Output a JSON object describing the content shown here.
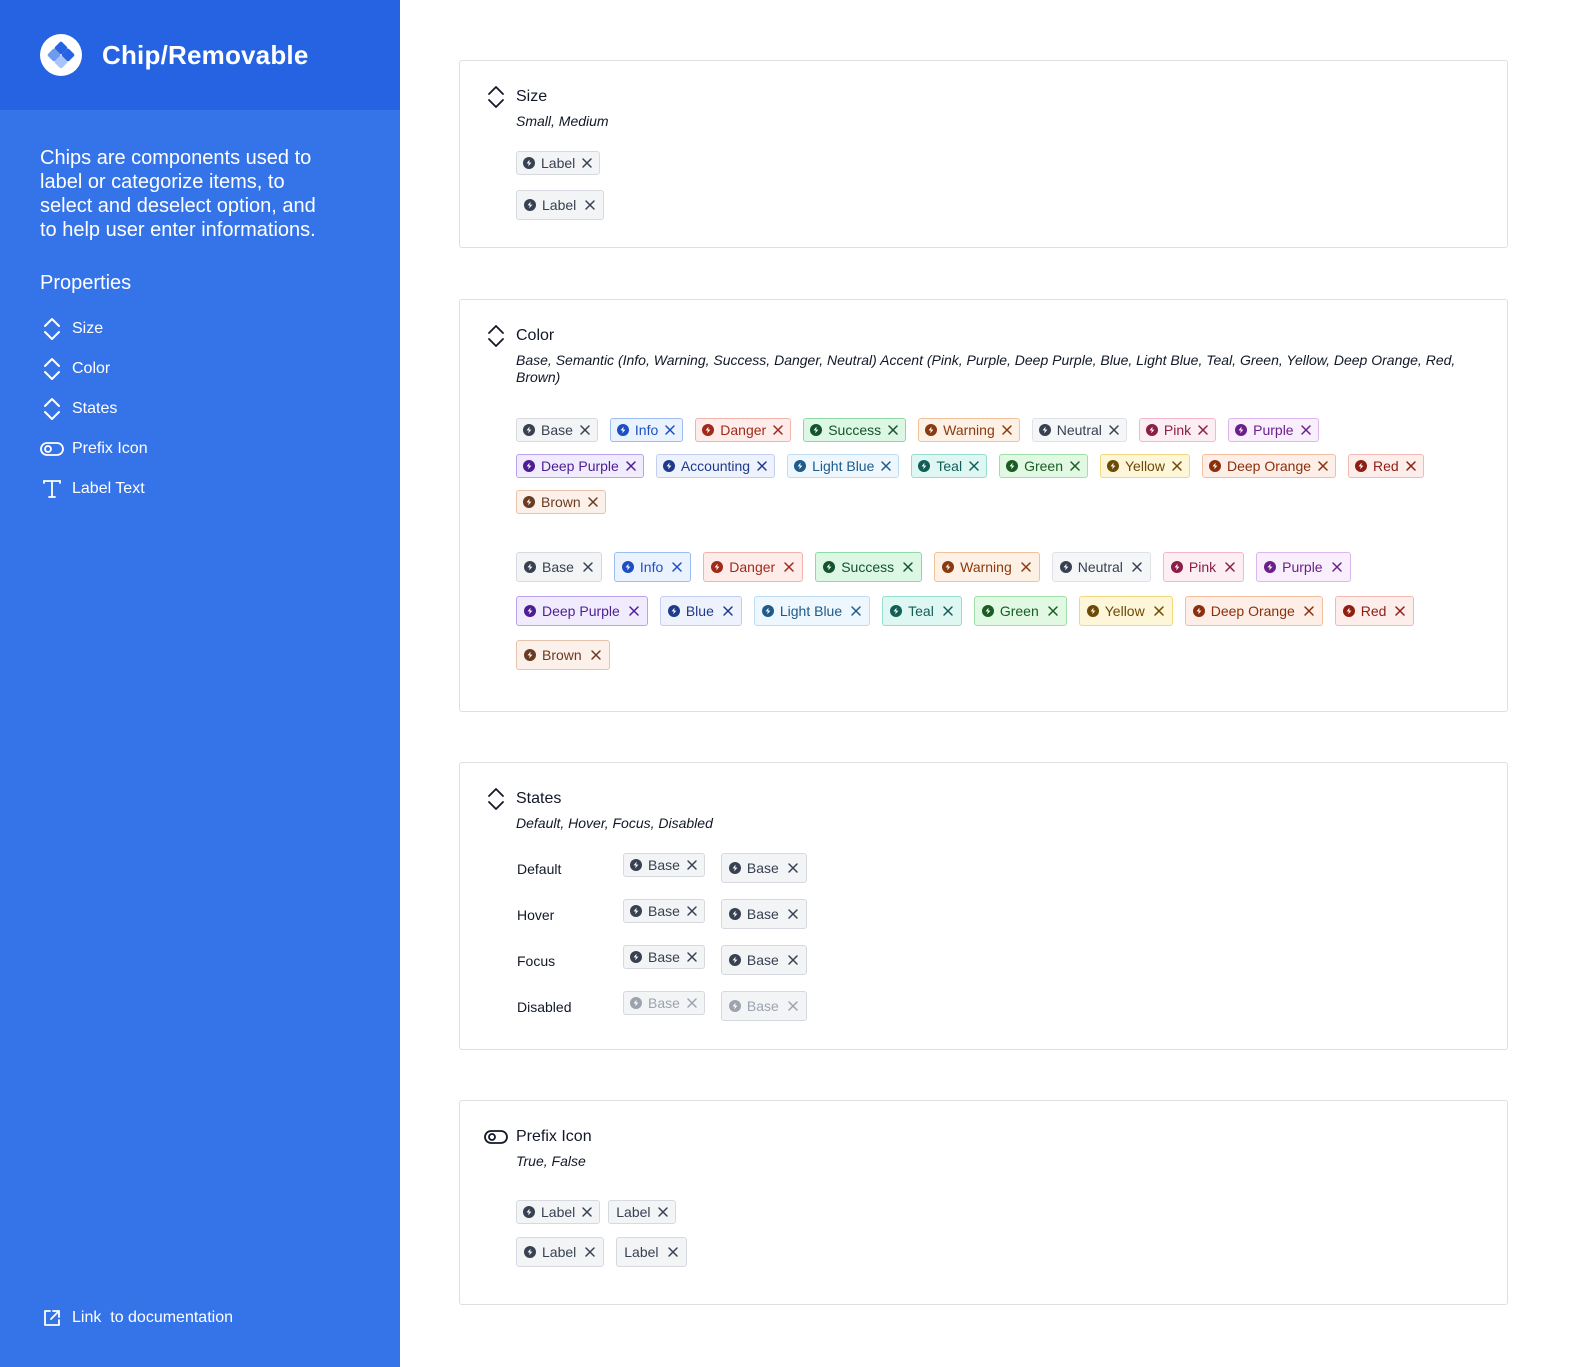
{
  "sidebar": {
    "title": "Chip/Removable",
    "description": "Chips are components used to label or categorize items, to select and deselect option, and to help user enter informations.",
    "properties_title": "Properties",
    "properties": [
      {
        "label": "Size",
        "icon": "chevron-up-down-icon"
      },
      {
        "label": "Color",
        "icon": "chevron-up-down-icon"
      },
      {
        "label": "States",
        "icon": "chevron-up-down-icon"
      },
      {
        "label": "Prefix Icon",
        "icon": "toggle-icon"
      },
      {
        "label": "Label Text",
        "icon": "text-icon"
      }
    ],
    "doc_link": "Link  to documentation",
    "colors": {
      "bg": "#3574e8",
      "header": "#2563e2"
    }
  },
  "size": {
    "title": "Size",
    "subtitle": "Small, Medium",
    "small_label": "Label",
    "medium_label": "Label"
  },
  "color": {
    "title": "Color",
    "subtitle": "Base, Semantic (Info, Warning, Success, Danger, Neutral) Accent (Pink, Purple, Deep Purple, Blue, Light Blue, Teal, Green, Yellow, Deep Orange, Red, Brown)",
    "small_row1": [
      "Base",
      "Info",
      "Danger",
      "Success",
      "Warning",
      "Neutral",
      "Pink",
      "Purple"
    ],
    "small_row2": [
      "Deep Purple",
      "Accounting",
      "Light Blue",
      "Teal",
      "Green",
      "Yellow",
      "Deep Orange",
      "Red"
    ],
    "small_row3": [
      "Brown"
    ],
    "medium_row1": [
      "Base",
      "Info",
      "Danger",
      "Success",
      "Warning",
      "Neutral",
      "Pink",
      "Purple"
    ],
    "medium_row2": [
      "Deep Purple",
      "Blue",
      "Light Blue",
      "Teal",
      "Green",
      "Yellow",
      "Deep Orange",
      "Red"
    ],
    "medium_row3": [
      "Brown"
    ]
  },
  "states": {
    "title": "States",
    "subtitle": "Default, Hover, Focus, Disabled",
    "rows": [
      {
        "label": "Default",
        "chip": "Base"
      },
      {
        "label": "Hover",
        "chip": "Base"
      },
      {
        "label": "Focus",
        "chip": "Base"
      },
      {
        "label": "Disabled",
        "chip": "Base"
      }
    ]
  },
  "prefix": {
    "title": "Prefix Icon",
    "subtitle": "True, False",
    "chip_label": "Label"
  }
}
